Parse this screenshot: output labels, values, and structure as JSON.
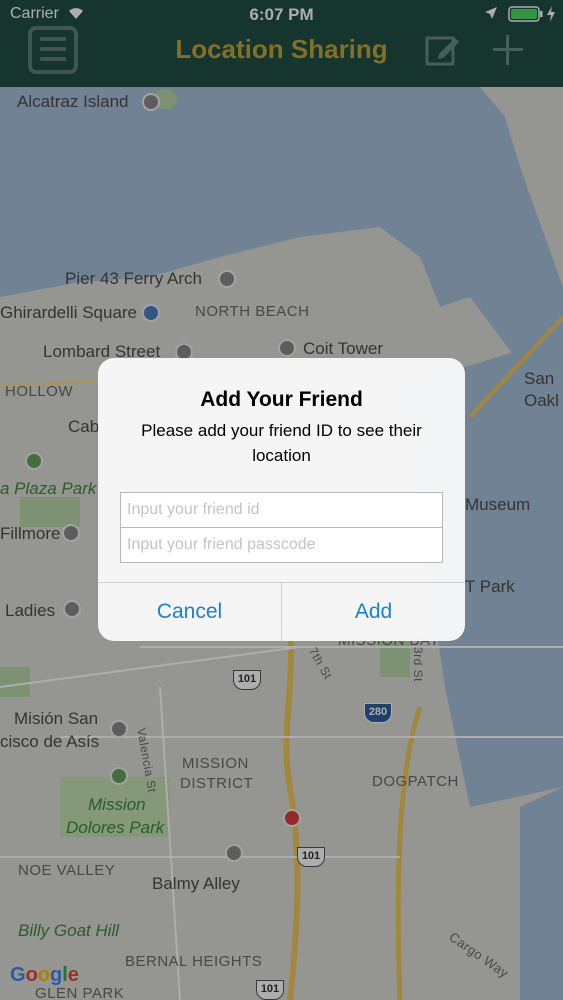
{
  "status": {
    "carrier": "Carrier",
    "time": "6:07 PM"
  },
  "nav": {
    "title": "Location Sharing",
    "menu_icon": "menu-icon",
    "edit_icon": "edit-icon",
    "add_icon": "plus-icon"
  },
  "colors": {
    "header_bg": "#1f4f45",
    "title": "#c2a63a",
    "water": "#a7c0dc",
    "land": "#dcdcd8",
    "park": "#b8d8a8",
    "road": "#f1c85a",
    "action": "#1a7fd6"
  },
  "map": {
    "labels": {
      "alcatraz": "Alcatraz Island",
      "pier43": "Pier 43 Ferry Arch",
      "ghirardelli": "Ghirardelli Square",
      "north_beach": "NORTH BEACH",
      "lombard": "Lombard Street",
      "coit": "Coit Tower",
      "hollow": "HOLLOW",
      "cab": "Cab",
      "san": "San",
      "oakl": "Oakl",
      "plaza_park": "a Plaza Park",
      "fillmore": "Fillmore",
      "museum": "Museum",
      "t_park": "T Park",
      "ladies": "Ladies",
      "mission_bay": "MISSION BAY",
      "mision_san": "Misión San",
      "cisco_asis": "cisco de Asís",
      "valencia": "Valencia St",
      "mission_district_1": "MISSION",
      "mission_district_2": "DISTRICT",
      "seventh": "7th St",
      "third": "3rd St",
      "dogpatch": "DOGPATCH",
      "mission_dolores_1": "Mission",
      "mission_dolores_2": "Dolores Park",
      "noe_valley": "NOE VALLEY",
      "balmy": "Balmy Alley",
      "billy_goat": "Billy Goat Hill",
      "bernal": "BERNAL HEIGHTS",
      "cargo_way": "Cargo Way",
      "glen_park": "GLEN PARK",
      "google": "Google"
    },
    "shields": {
      "s101a": "101",
      "s101b": "101",
      "s101c": "101",
      "s280": "280"
    }
  },
  "dialog": {
    "title": "Add Your Friend",
    "message": "Please add your friend ID to see their location",
    "friend_id_placeholder": "Input your friend id",
    "passcode_placeholder": "Input your friend passcode",
    "cancel_label": "Cancel",
    "add_label": "Add"
  }
}
